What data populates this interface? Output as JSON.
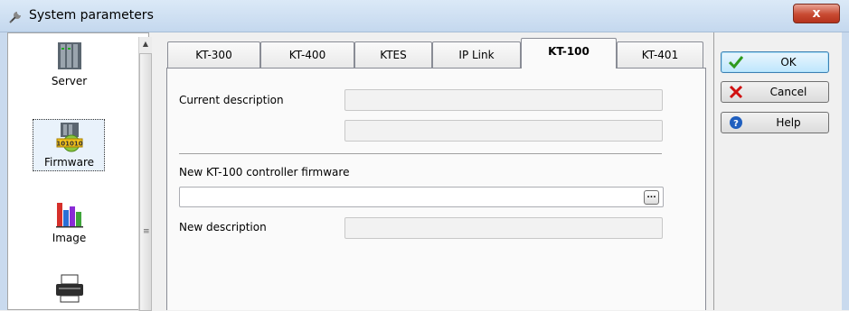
{
  "window": {
    "title": "System parameters",
    "close_label": "x"
  },
  "sidebar": {
    "items": [
      {
        "label": "Server",
        "icon": "server-icon"
      },
      {
        "label": "Firmware",
        "icon": "firmware-icon",
        "selected": true
      },
      {
        "label": "Image",
        "icon": "image-chart-icon"
      },
      {
        "label": "",
        "icon": "printer-icon"
      }
    ],
    "grip": "≡"
  },
  "tabs": [
    {
      "label": "KT-300"
    },
    {
      "label": "KT-400"
    },
    {
      "label": "KTES"
    },
    {
      "label": "IP Link"
    },
    {
      "label": "KT-100",
      "active": true
    },
    {
      "label": "KT-401"
    }
  ],
  "panel": {
    "current_description_label": "Current description",
    "current_description_line1": "",
    "current_description_line2": "",
    "new_firmware_label": "New KT-100 controller firmware",
    "firmware_path": "",
    "browse_label": "...",
    "new_description_label": "New description",
    "new_description": ""
  },
  "buttons": {
    "ok": "OK",
    "cancel": "Cancel",
    "help": "Help"
  },
  "colors": {
    "ok_check": "#2f9a1e",
    "cancel_x": "#d01010",
    "help_blue": "#1f5fbf",
    "close_red": "#c84a32"
  }
}
